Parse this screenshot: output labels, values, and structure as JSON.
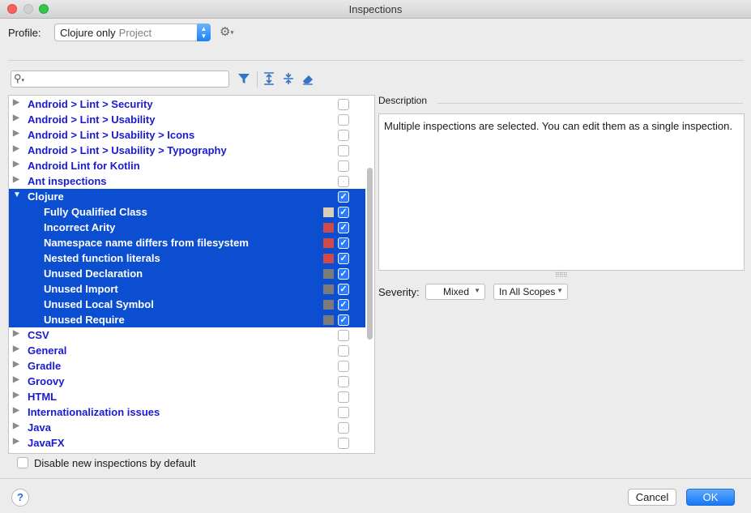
{
  "window": {
    "title": "Inspections"
  },
  "profile": {
    "label": "Profile:",
    "name": "Clojure only",
    "scope": "Project"
  },
  "search": {
    "placeholder": ""
  },
  "tree": {
    "items": [
      {
        "label": "Android > Lint > Security",
        "level": 0,
        "expanded": false,
        "selected": false,
        "checked": false
      },
      {
        "label": "Android > Lint > Usability",
        "level": 0,
        "expanded": false,
        "selected": false,
        "checked": false
      },
      {
        "label": "Android > Lint > Usability > Icons",
        "level": 0,
        "expanded": false,
        "selected": false,
        "checked": false
      },
      {
        "label": "Android > Lint > Usability > Typography",
        "level": 0,
        "expanded": false,
        "selected": false,
        "checked": false
      },
      {
        "label": "Android Lint for Kotlin",
        "level": 0,
        "expanded": false,
        "selected": false,
        "checked": false
      },
      {
        "label": "Ant inspections",
        "level": 0,
        "expanded": false,
        "selected": false,
        "checked": false
      },
      {
        "label": "Clojure",
        "level": 0,
        "expanded": true,
        "selected": true,
        "checked": true
      },
      {
        "label": "Fully Qualified Class",
        "level": 1,
        "selected": true,
        "checked": true,
        "severity_color": "#d8cfb6"
      },
      {
        "label": "Incorrect Arity",
        "level": 1,
        "selected": true,
        "checked": true,
        "severity_color": "#d14a4a"
      },
      {
        "label": "Namespace name differs from filesystem",
        "level": 1,
        "selected": true,
        "checked": true,
        "severity_color": "#d14a4a"
      },
      {
        "label": "Nested function literals",
        "level": 1,
        "selected": true,
        "checked": true,
        "severity_color": "#d14a4a"
      },
      {
        "label": "Unused Declaration",
        "level": 1,
        "selected": true,
        "checked": true,
        "severity_color": "#7a7a7a"
      },
      {
        "label": "Unused Import",
        "level": 1,
        "selected": true,
        "checked": true,
        "severity_color": "#7a7a7a"
      },
      {
        "label": "Unused Local Symbol",
        "level": 1,
        "selected": true,
        "checked": true,
        "severity_color": "#7a7a7a"
      },
      {
        "label": "Unused Require",
        "level": 1,
        "selected": true,
        "checked": true,
        "severity_color": "#7a7a7a"
      },
      {
        "label": "CSV",
        "level": 0,
        "expanded": false,
        "selected": false,
        "checked": false
      },
      {
        "label": "General",
        "level": 0,
        "expanded": false,
        "selected": false,
        "checked": false
      },
      {
        "label": "Gradle",
        "level": 0,
        "expanded": false,
        "selected": false,
        "checked": false
      },
      {
        "label": "Groovy",
        "level": 0,
        "expanded": false,
        "selected": false,
        "checked": false
      },
      {
        "label": "HTML",
        "level": 0,
        "expanded": false,
        "selected": false,
        "checked": false
      },
      {
        "label": "Internationalization issues",
        "level": 0,
        "expanded": false,
        "selected": false,
        "checked": false
      },
      {
        "label": "Java",
        "level": 0,
        "expanded": false,
        "selected": false,
        "checked": false
      },
      {
        "label": "JavaFX",
        "level": 0,
        "expanded": false,
        "selected": false,
        "checked": false
      }
    ]
  },
  "options": {
    "disable_new_label": "Disable new inspections by default",
    "disable_new_checked": false
  },
  "description": {
    "label": "Description",
    "text": "Multiple inspections are selected. You can edit them as a single inspection."
  },
  "severity": {
    "label": "Severity:",
    "value": "Mixed",
    "scope": "In All Scopes"
  },
  "buttons": {
    "help": "?",
    "cancel": "Cancel",
    "ok": "OK"
  },
  "colors": {
    "selection": "#0c4ed0",
    "link_text": "#1a1ad0",
    "ok_button": "#1677f6"
  }
}
